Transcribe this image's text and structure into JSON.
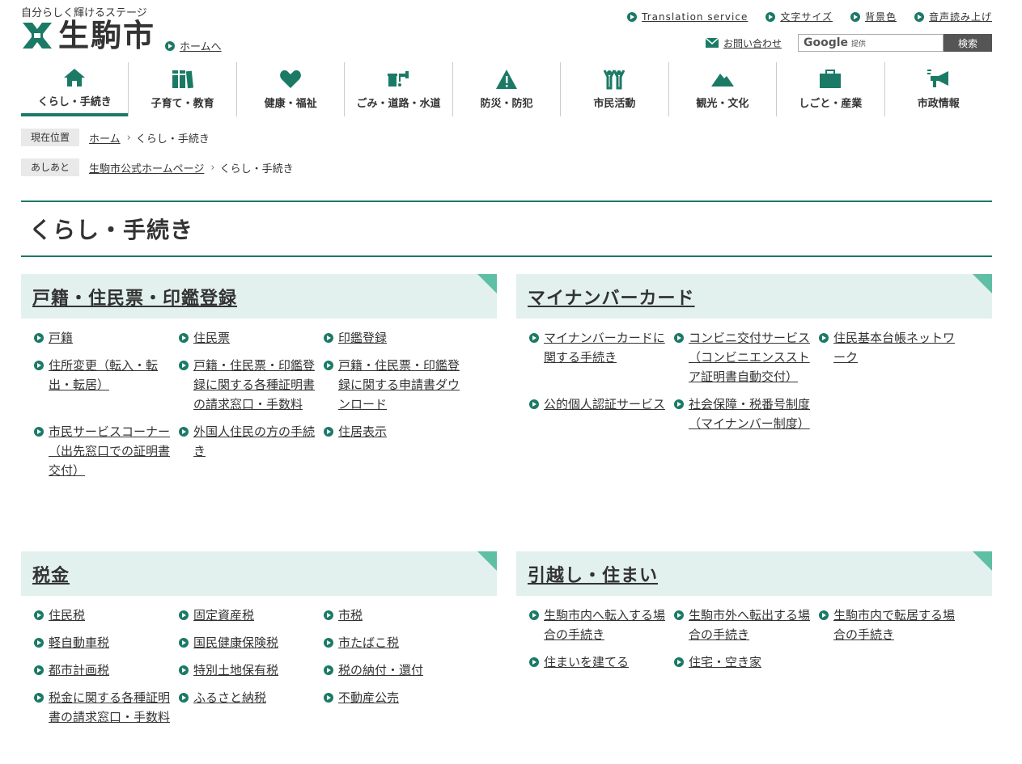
{
  "header": {
    "tagline": "自分らしく輝けるステージ",
    "logo_text": "生駒市",
    "home_link": "ホームへ",
    "utility": [
      "Translation service",
      "文字サイズ",
      "背景色",
      "音声読み上げ"
    ],
    "contact": "お問い合わせ",
    "search": {
      "brand": "Google",
      "brand_suffix": "提供",
      "button": "検索"
    }
  },
  "nav": [
    {
      "label": "くらし・手続き",
      "icon": "home-icon",
      "active": true
    },
    {
      "label": "子育て・教育",
      "icon": "books-icon"
    },
    {
      "label": "健康・福祉",
      "icon": "heart-icon"
    },
    {
      "label": "ごみ・道路・水道",
      "icon": "faucet-icon"
    },
    {
      "label": "防災・防犯",
      "icon": "warning-icon"
    },
    {
      "label": "市民活動",
      "icon": "people-icon"
    },
    {
      "label": "観光・文化",
      "icon": "mountain-icon"
    },
    {
      "label": "しごと・産業",
      "icon": "briefcase-icon"
    },
    {
      "label": "市政情報",
      "icon": "megaphone-icon"
    }
  ],
  "breadcrumb": {
    "label": "現在位置",
    "home": "ホーム",
    "current": "くらし・手続き"
  },
  "footprint": {
    "label": "あしあと",
    "home": "生駒市公式ホームページ",
    "current": "くらし・手続き"
  },
  "page_title": "くらし・手続き",
  "colors": {
    "accent": "#1b7a66",
    "section_bg": "#e3f1ee",
    "corner": "#5fbfa4"
  },
  "sections": [
    {
      "title": "戸籍・住民票・印鑑登録",
      "links": [
        "戸籍",
        "住民票",
        "印鑑登録",
        "住所変更（転入・転出・転居）",
        "戸籍・住民票・印鑑登録に関する各種証明書の請求窓口・手数料",
        "戸籍・住民票・印鑑登録に関する申請書ダウンロード",
        "市民サービスコーナー（出先窓口での証明書交付）",
        "外国人住民の方の手続き",
        "住居表示"
      ]
    },
    {
      "title": "マイナンバーカード",
      "links": [
        "マイナンバーカードに関する手続き",
        "コンビニ交付サービス（コンビニエンスストア証明書自動交付）",
        "住民基本台帳ネットワーク",
        "公的個人認証サービス",
        "社会保障・税番号制度（マイナンバー制度）"
      ]
    },
    {
      "title": "税金",
      "links": [
        "住民税",
        "固定資産税",
        "市税",
        "軽自動車税",
        "国民健康保険税",
        "市たばこ税",
        "都市計画税",
        "特別土地保有税",
        "税の納付・還付",
        "税金に関する各種証明書の請求窓口・手数料",
        "ふるさと納税",
        "不動産公売"
      ]
    },
    {
      "title": "引越し・住まい",
      "links": [
        "生駒市内へ転入する場合の手続き",
        "生駒市外へ転出する場合の手続き",
        "生駒市内で転居する場合の手続き",
        "住まいを建てる",
        "住宅・空き家"
      ]
    }
  ]
}
